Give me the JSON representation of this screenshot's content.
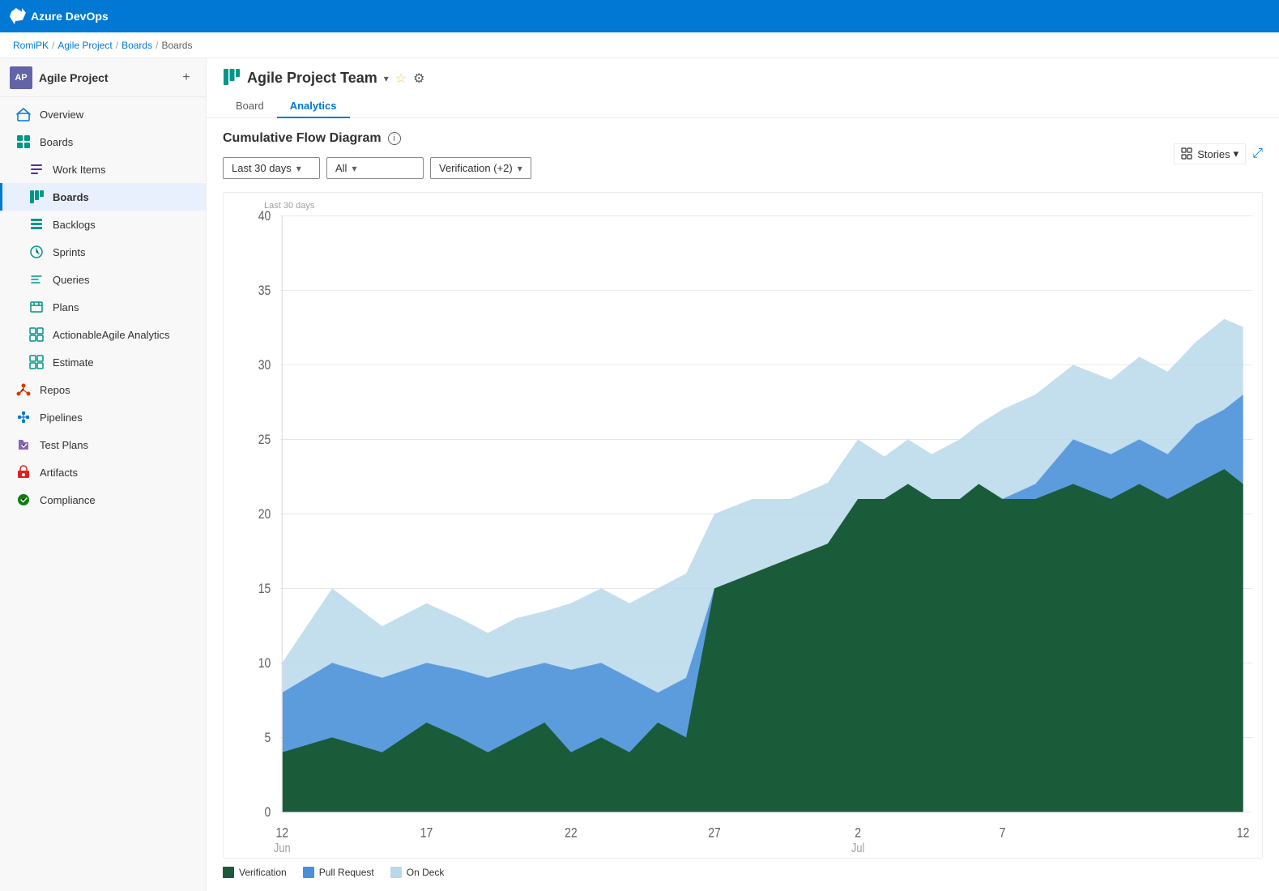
{
  "app": {
    "title": "Azure DevOps",
    "logo_color": "#0078d4"
  },
  "breadcrumb": {
    "items": [
      "RomiPK",
      "Agile Project",
      "Boards",
      "Boards"
    ],
    "separators": [
      "/",
      "/",
      "/"
    ]
  },
  "sidebar": {
    "project": {
      "initials": "AP",
      "name": "Agile Project",
      "add_label": "+"
    },
    "nav_items": [
      {
        "id": "overview",
        "label": "Overview",
        "icon": "home",
        "active": false
      },
      {
        "id": "boards-section",
        "label": "Boards",
        "icon": "boards",
        "active": false,
        "section": true
      },
      {
        "id": "work-items",
        "label": "Work Items",
        "icon": "list",
        "active": false
      },
      {
        "id": "boards",
        "label": "Boards",
        "icon": "grid",
        "active": true
      },
      {
        "id": "backlogs",
        "label": "Backlogs",
        "icon": "backlogs",
        "active": false
      },
      {
        "id": "sprints",
        "label": "Sprints",
        "icon": "sprints",
        "active": false
      },
      {
        "id": "queries",
        "label": "Queries",
        "icon": "queries",
        "active": false
      },
      {
        "id": "plans",
        "label": "Plans",
        "icon": "plans",
        "active": false
      },
      {
        "id": "actionable",
        "label": "ActionableAgile Analytics",
        "icon": "grid",
        "active": false
      },
      {
        "id": "estimate",
        "label": "Estimate",
        "icon": "grid",
        "active": false
      },
      {
        "id": "repos",
        "label": "Repos",
        "icon": "repos",
        "active": false
      },
      {
        "id": "pipelines",
        "label": "Pipelines",
        "icon": "pipelines",
        "active": false
      },
      {
        "id": "testplans",
        "label": "Test Plans",
        "icon": "testplans",
        "active": false
      },
      {
        "id": "artifacts",
        "label": "Artifacts",
        "icon": "artifacts",
        "active": false
      },
      {
        "id": "compliance",
        "label": "Compliance",
        "icon": "compliance",
        "active": false
      }
    ]
  },
  "page": {
    "board_icon": "📋",
    "title": "Agile Project Team",
    "tabs": [
      {
        "label": "Board",
        "active": false
      },
      {
        "label": "Analytics",
        "active": true
      }
    ],
    "stories_label": "Stories",
    "expand_label": "⤢"
  },
  "chart": {
    "title": "Cumulative Flow Diagram",
    "period_label": "Last 30 days",
    "filters": [
      {
        "label": "Last 30 days",
        "id": "period"
      },
      {
        "label": "All",
        "id": "swimlane"
      },
      {
        "label": "Verification (+2)",
        "id": "columns"
      }
    ],
    "y_axis": [
      0,
      5,
      10,
      15,
      20,
      25,
      30,
      35,
      40
    ],
    "x_axis_labels": [
      "12\nJun",
      "17",
      "22",
      "27",
      "2\nJul",
      "7",
      "12"
    ],
    "legend": [
      {
        "label": "Verification",
        "color": "#1a5c3a"
      },
      {
        "label": "Pull Request",
        "color": "#4a90d9"
      },
      {
        "label": "On Deck",
        "color": "#b8d8ea"
      }
    ]
  }
}
